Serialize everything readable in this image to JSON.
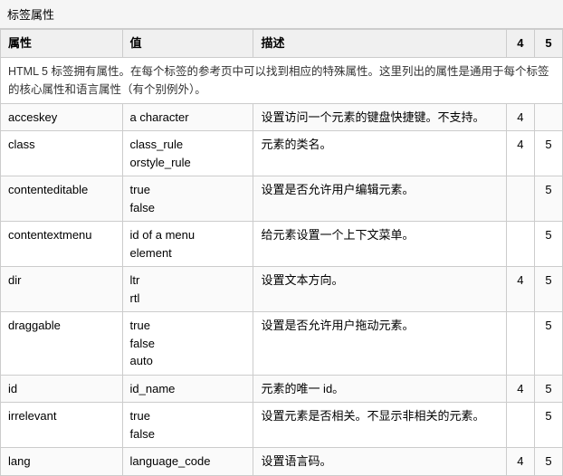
{
  "page": {
    "title": "标签属性",
    "intro": "HTML 5 标签拥有属性。在每个标签的参考页中可以找到相应的特殊属性。这里列出的属性是通用于每个标签的核心属性和语言属性（有个别例外）。",
    "headers": {
      "attr": "属性",
      "value": "值",
      "desc": "描述",
      "col4": "4",
      "col5": "5"
    },
    "rows": [
      {
        "attr": "acceskey",
        "values": [
          "a character"
        ],
        "desc": "设置访问一个元素的键盘快捷键。不支持。",
        "col4": "4",
        "col5": ""
      },
      {
        "attr": "class",
        "values": [
          "class_rule",
          "orstyle_rule"
        ],
        "desc": "元素的类名。",
        "col4": "4",
        "col5": "5"
      },
      {
        "attr": "contenteditable",
        "values": [
          "true",
          "false"
        ],
        "desc": "设置是否允许用户编辑元素。",
        "col4": "",
        "col5": "5"
      },
      {
        "attr": "contentextmenu",
        "values": [
          "id  of  a  menu",
          "element"
        ],
        "desc": "给元素设置一个上下文菜单。",
        "col4": "",
        "col5": "5"
      },
      {
        "attr": "dir",
        "values": [
          "ltr",
          "rtl"
        ],
        "desc": "设置文本方向。",
        "col4": "4",
        "col5": "5"
      },
      {
        "attr": "draggable",
        "values": [
          "true",
          "false",
          "auto"
        ],
        "desc": "设置是否允许用户拖动元素。",
        "col4": "",
        "col5": "5"
      },
      {
        "attr": "id",
        "values": [
          "id_name"
        ],
        "desc": "元素的唯一 id。",
        "col4": "4",
        "col5": "5"
      },
      {
        "attr": "irrelevant",
        "values": [
          "true",
          "false"
        ],
        "desc": "设置元素是否相关。不显示非相关的元素。",
        "col4": "",
        "col5": "5"
      },
      {
        "attr": "lang",
        "values": [
          "language_code"
        ],
        "desc": "设置语言码。",
        "col4": "4",
        "col5": "5"
      }
    ]
  }
}
